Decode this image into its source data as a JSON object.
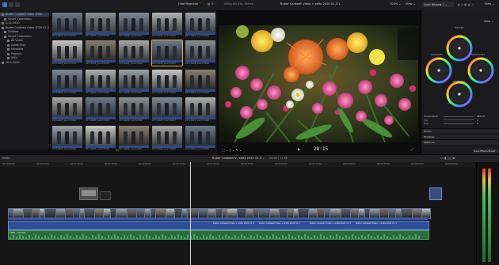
{
  "toolbar": {
    "hide_rejected": "Hide Rejected ⌃",
    "viewer_format": "1080p HD 25p, Stereo",
    "clip_title": "Butler Caldwell Video + edits 2020 V1.3 ↓",
    "zoom": "104% ⌄",
    "view": "View ⌄",
    "inspector_title": "Color Wheels 1 ⌄",
    "inspector_view": "View ⌄"
  },
  "library": {
    "items": [
      {
        "label": "Butler Caldwell Video 2020",
        "selected": true
      },
      {
        "label": "Smart Collections",
        "selected": false
      },
      {
        "label": "5-12-2020",
        "selected": false
      },
      {
        "label": "Butler Caldwell Video 2020 V1.3",
        "selected": false
      },
      {
        "label": "Untitled",
        "selected": false
      },
      {
        "label": "Smart Collections",
        "selected": false
      },
      {
        "label": "All Video",
        "selected": false
      },
      {
        "label": "Audio Only",
        "selected": false
      },
      {
        "label": "Favorites",
        "selected": false
      },
      {
        "label": "Projects",
        "selected": false
      },
      {
        "label": "Stills",
        "selected": false
      },
      {
        "label": "28-5-2020",
        "selected": false
      }
    ]
  },
  "browser": {
    "footer": "1 of 218 selected, 11:56",
    "captions": [
      "20-5-2020_Lunch 0009",
      "20-5-2020_Lunch 0010",
      "20-5-2020_Lunch 0011",
      "20-5-2020_Lunch 0012",
      "20-5-2020_Lunch 0013",
      "20-5-2020_Lunch 0014",
      "20-5-2020_Lunch 0015",
      "20-5-2020_Lunch 0016",
      "20-5-2020_Lunch 0017",
      "20-5-2020_Lunch 0018",
      "20-5-2020_Lunch 0019",
      "20-5-2020_Lunch 0020",
      "20-5-2020_Lunch 0021",
      "20-5-2020_Lunch 0022",
      "20-5-2020_Lunch 0023",
      "20-5-2020_Lunch 0024",
      "20-5-2020_Lunch 0025",
      "20-5-2020_Lunch 0026",
      "20-5-2020_Lunch 0027",
      "20-5-2020_Lunch 0028",
      "20-5-2020_Lunch 0029",
      "20-5-2020_Lunch 0030",
      "20-5-2020_Lunch 0031",
      "20-5-2020_Lunch 0032",
      "20-5-2020_Lunch 0033"
    ]
  },
  "viewer": {
    "timecode": "28:15",
    "play_icon": "▶",
    "tools": "⬚ ⌄  ◊ ⌄  ✎ ⌄"
  },
  "inspector": {
    "master_label": "MASTER",
    "shadows_label": "SHADOWS",
    "highlights_label": "HIGHLIGHTS",
    "midtones_label": "MIDTONES",
    "params": [
      {
        "label": "Temperature",
        "value": "4875.5"
      },
      {
        "label": "Tint",
        "value": "0"
      },
      {
        "label": "Hue",
        "value": "0"
      }
    ],
    "sections": [
      "Global",
      "Shadows",
      "Midtones"
    ],
    "save_button": "Save Effects Preset"
  },
  "timeline": {
    "index_label": "Index",
    "project_title": "Butler Caldwell V...edits 2020 V1.3 ⌄",
    "duration": "00:00 / 11:56",
    "ruler": [
      "00:00:00:00",
      "00:00:30:00",
      "00:01:00:00",
      "00:01:30:00",
      "00:02:00:00",
      "00:02:30:00",
      "00:03:00:00",
      "00:03:30:00",
      "00:04:00:00",
      "00:04:30:00",
      "00:05:00:00",
      "00:05:30:00",
      "00:06:00:00",
      "00:06:30:00"
    ],
    "audio_clip_label": "Butler Caldwell Video + edits 2020 V1.3",
    "music_label": "APRIL - Sampler"
  },
  "colors": {
    "accent": "#e0b23a",
    "selection": "#2e3a55",
    "audio": "#2c4f9a",
    "music": "#2c6b3b",
    "playhead": "#d9d9d9"
  }
}
